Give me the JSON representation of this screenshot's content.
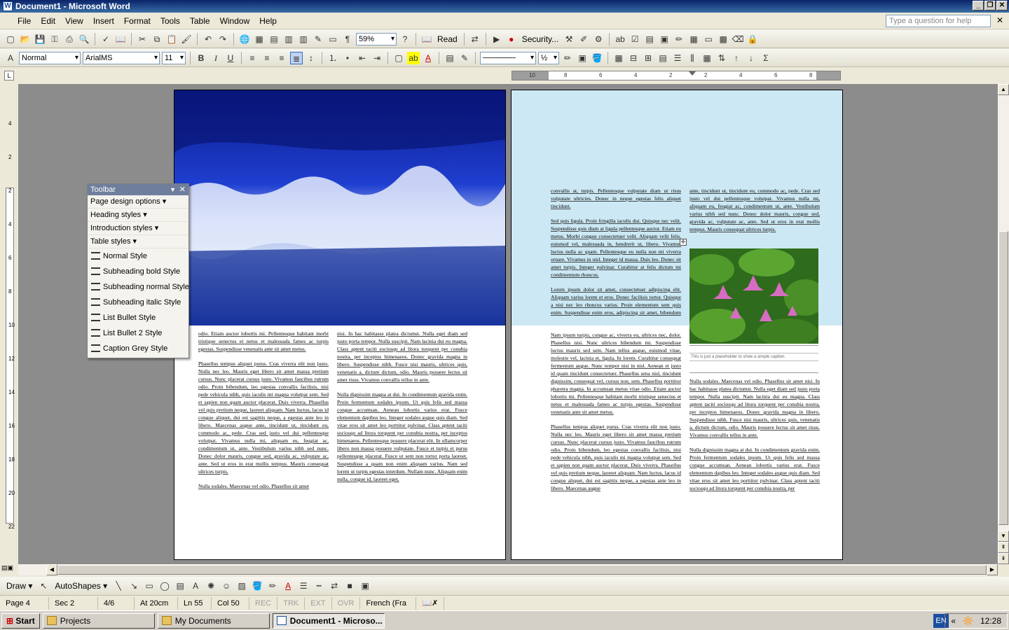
{
  "window": {
    "title": "Document1 - Microsoft Word"
  },
  "menu": [
    "File",
    "Edit",
    "View",
    "Insert",
    "Format",
    "Tools",
    "Table",
    "Window",
    "Help"
  ],
  "help_placeholder": "Type a question for help",
  "standard_toolbar": {
    "zoom": "59%",
    "read_label": "Read",
    "security_label": "Security..."
  },
  "formatting_toolbar": {
    "style": "Normal",
    "font": "ArialMS",
    "size": "11"
  },
  "ruler_labels": [
    "10",
    "8",
    "6",
    "4",
    "2",
    "2",
    "4",
    "6",
    "8"
  ],
  "vruler_labels": [
    "4",
    "2",
    "2",
    "4",
    "6",
    "8",
    "10",
    "12",
    "14",
    "16",
    "18",
    "20",
    "22"
  ],
  "floating_toolbar": {
    "title": "Toolbar",
    "menus": [
      "Page design options",
      "Heading styles",
      "Introduction styles",
      "Table styles"
    ],
    "styles": [
      "Normal Style",
      "Subheading bold Style",
      "Subheading normal Style",
      "Subheading italic Style",
      "List Bullet Style",
      "List Bullet 2 Style",
      "Caption Grey Style"
    ]
  },
  "page1": {
    "col1": [
      "odio. Etiam auctor lobortis mi. Pellentesque habitant morbi tristique senectus et netus et malesuada fames ac turpis egestas. Suspendisse venenatis ante sit amet metus.",
      "Phasellus tempus aliquet purus. Cras viverra elit non justo. Nulla nec leo. Mauris eget libero sit amet massa pretium cursus. Nunc placerat cursus justo. Vivamus faucibus rutrum odio. Proin bibendum, leo egestas convallis facilisis, nisi pede vehicula nibh, quis iaculis mi magna volutpat sem. Sed et sapien non quam auctor placerat. Duis viverra. Phasellus vel quis pretium neque, laoreet aliquam. Nam luctus, lacus id congue aliquet, dui est sagittis neque, a egestas ante leo in libero. Maecenas augue ante, tincidunt ut, tincidunt eu, commodo ac, pede. Cras sed justo vel dui pellentesque volutpat. Vivamus nulla mi, aliquam eu, feugiat ac, condimentum ut, ante. Vestibulum varius nibh sed nunc. Donec dolor mauris, congue sed, gravida ac, vulputate ac, ante. Sed ut eros in erat mollis tempus. Mauris consequat ultrices turpis.",
      "Nulla sodales. Maecenas vel odio. Phasellus sit amet"
    ],
    "col2": [
      "nisi. In hac habitasse platea dictumst. Nulla eget diam sed justo porta tempor. Nulla suscipit. Nam lacinia dui eu magna. Class aptent taciti sociosqu ad litora torquent per conubia nostra, per inceptos himenaeos. Donec gravida magna in libero. Suspendisse nibh. Fusce nisi mauris, ultrices quis, venenatis a, dictum dictum, odio. Mauris posuere lectus sit amet risus. Vivamus convallis tellus in ante.",
      "Nulla dignissim magna at dui. In condimentum gravida enim. Proin fermentum sodales ipsum. Ut quis felis sed massa congue accumsan. Aenean lobortis varius erat. Fusce elementum dapibus leo. Integer sodales augue quis diam. Sed vitae eros sit amet leo porttitor pulvinar. Class aptent taciti sociosqu ad litora torquent per conubia nostra, per inceptos himenaeos. Pellentesque posuere placerat elit. In ullamcorper libero non massa posuere vulputate. Fusce et turpis et purus pellentesque placerat. Fusce ut sem non tortor porta laoreet. Suspendisse a quam non enim aliquam varius. Nam sed lorem ut turpis egestas interdum. Nullam nunc. Aliquam enim nulla, congue id, laoreet eget,"
    ]
  },
  "page2": {
    "col1_top": [
      "convallis at, turpis. Pellentesque vulputate diam ut risus vulputate ultricies. Donec in neque egestas felis aliquet tincidunt.",
      "Sed quis ligula. Proin fringilla iaculis dui. Quisque nec velit. Suspendisse quis diam at ligula pellentesque auctor. Etiam eu metus. Morbi congue consectetuer velit. Aliquam velit felis, euismod vel, malesuada in, hendrerit ut, libero. Vivamus luctus nulla ac quam. Pellentesque eu nulla non mi viverra ornare. Vivamus in nisl. Integer id massa. Duis leo. Donec sit amet turpis. Integer pulvinar. Curabitur at felis dictum mi condimentum rhoncus.",
      "Lorem ipsum dolor sit amet, consectetuer adipiscing elit. Aliquam varius lorem et eros. Donec facilisis tortor. Quisque a nisi nec leo rhoncus varius. Proin elementum sem quis enim. Suspendisse enim eros, adipiscing sit amet, bibendum ac, imperdiet a, orci."
    ],
    "col1_bottom": [
      "Nam ipsum turpis, congue ac, viverra eu, ultrices nec, dolor. Phasellus nisi. Nunc ultrices bibendum mi. Suspendisse luctus mauris sed sem. Nam tellus augue, euismod vitae, molestie vel, lacinia et, ligula. In lorem. Curabitur consequat fermentum augue. Nunc tempor nisi in nisl. Aenean et justo id quam tincidunt consectetuer. Phasellus urna nisl, tincidunt dignissim, consequat vel, cursus non, sem. Phasellus porttitor pharetra magna. In accumsan metus vitae odio. Etiam auctor lobortis mi. Pellentesque habitant morbi tristique senectus et netus et malesuada fames ac turpis egestas. Suspendisse venenatis ante sit amet metus.",
      "Phasellus tempus aliquet purus. Cras viverra elit non justo. Nulla nec leo. Mauris eget libero sit amet massa pretium cursus. Nunc placerat cursus justo. Vivamus faucibus rutrum odio. Proin bibendum, leo egestas convallis facilisis, nisi pede vehicula nibh, quis iaculis mi magna volutpat sem. Sed et sapien non quam auctor placerat. Duis viverra. Phasellus vel quis pretium neque, laoreet aliquam. Nam luctus, lacus id congue aliquet, dui est sagittis neque, a egestas ante leo in libero. Maecenas augue"
    ],
    "col2_top": [
      "ante, tincidunt ut, tincidunt eu, commodo ac, pede. Cras sed justo vel dui pellentesque volutpat. Vivamus nulla mi, aliquam eu, feugiat ac, condimentum ut, ante. Vestibulum varius nibh sed nunc. Donec dolor mauris, congue sed, gravida ac, vulputate ac, ante. Sed ut eros in erat mollis tempus. Mauris consequat ultrices turpis."
    ],
    "caption": "This is just a placeholder to show a simple caption.",
    "col2_bottom": [
      "Nulla sodales. Maecenas vel odio. Phasellus sit amet nisi. In hac habitasse platea dictumst. Nulla eget diam sed justo porta tempor. Nulla suscipit. Nam lacinia dui eu magna. Class aptent taciti sociosqu ad litora torquent per conubia nostra, per inceptos himenaeos. Donec gravida magna in libero. Suspendisse nibh. Fusce nisi mauris, ultrices quis, venenatis a, dictum dictum, odio. Mauris posuere lectus sit amet risus. Vivamus convallis tellus in ante.",
      "Nulla dignissim magna at dui. In condimentum gravida enim. Proin fermentum sodales ipsum. Ut quis felis sed massa congue accumsan. Aenean lobortis varius erat. Fusce elementum dapibus leo. Integer sodales augue quis diam. Sed vitae eros sit amet leo porttitor pulvinar. Class aptent taciti sociosqu ad litora torquent per conubia nostra, per"
    ]
  },
  "draw_toolbar": {
    "draw": "Draw",
    "autoshapes": "AutoShapes"
  },
  "status": {
    "page": "Page 4",
    "sec": "Sec 2",
    "pages": "4/6",
    "at": "At 20cm",
    "ln": "Ln 55",
    "col": "Col 50",
    "rec": "REC",
    "trk": "TRK",
    "ext": "EXT",
    "ovr": "OVR",
    "lang": "French (Fra"
  },
  "taskbar": {
    "start": "Start",
    "tasks": [
      "Projects",
      "My Documents",
      "Document1 - Microso..."
    ],
    "lang": "EN",
    "clock": "12:28"
  },
  "colors": {
    "title_bar": "#0a246a",
    "page_tint": "#cce8f4",
    "workspace": "#8c8c8c"
  }
}
